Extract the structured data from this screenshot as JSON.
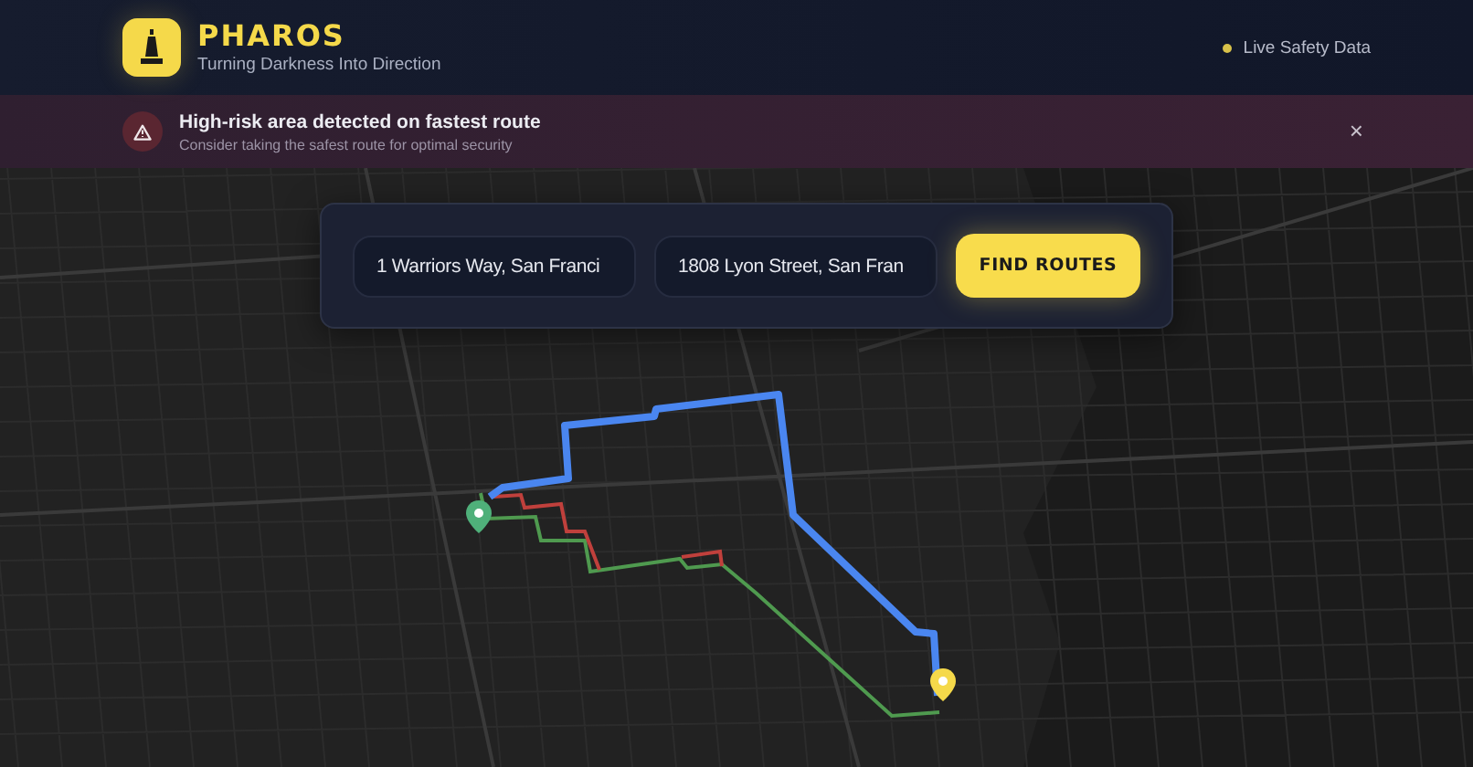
{
  "header": {
    "title": "PHAROS",
    "subtitle": "Turning Darkness Into Direction",
    "status": "Live Safety Data"
  },
  "alert": {
    "title": "High-risk area detected on fastest route",
    "message": "Consider taking the safest route for optimal security",
    "close": "×"
  },
  "search": {
    "origin": "1 Warriors Way, San Franci",
    "destination": "1808 Lyon Street, San Fran",
    "button": "FIND ROUTES"
  }
}
